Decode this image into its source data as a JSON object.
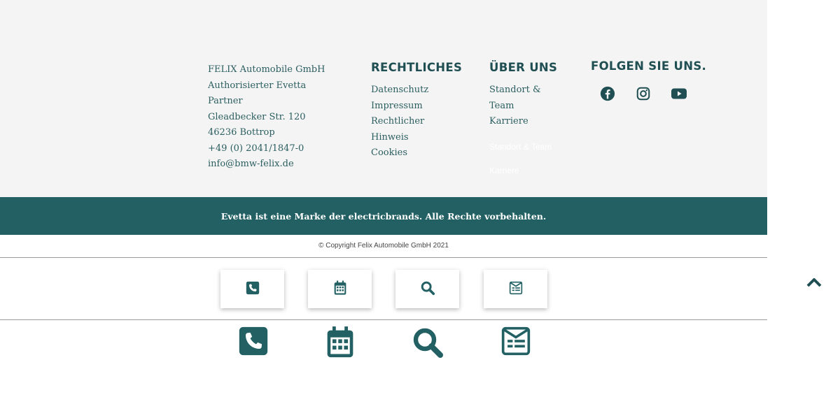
{
  "contact": {
    "lines": [
      "FELIX Automobile GmbH",
      "Authorisierter Evetta",
      "Partner",
      "Gleadbecker Str. 120",
      "46236 Bottrop",
      "+49 (0) 2041/1847-0",
      "info@bmw-felix.de"
    ]
  },
  "legal": {
    "heading": "RECHTLICHES",
    "links": [
      "Datenschutz",
      "Impressum",
      "Rechtlicher",
      "Hinweis",
      "Cookies"
    ]
  },
  "about": {
    "heading": "ÜBER UNS",
    "links": [
      "Standort &",
      "Team",
      "Karriere"
    ],
    "hidden_links": [
      "Standort & Team",
      "Karriere"
    ]
  },
  "follow": {
    "heading": "FOLGEN SIE UNS.",
    "icons": [
      "facebook-icon",
      "instagram-icon",
      "youtube-icon"
    ]
  },
  "brand_bar": {
    "text": "Evetta ist eine Marke der electricbrands. Alle Rechte vorbehalten."
  },
  "copyright": {
    "text": "© Copyright Felix Automobile GmbH 2021"
  },
  "quick_actions": {
    "icons": [
      "phone-icon",
      "calendar-icon",
      "search-icon",
      "newsletter-icon"
    ]
  },
  "colors": {
    "accent": "#226063",
    "text": "#2b5e60",
    "footer_bg": "#f4f4f4"
  }
}
